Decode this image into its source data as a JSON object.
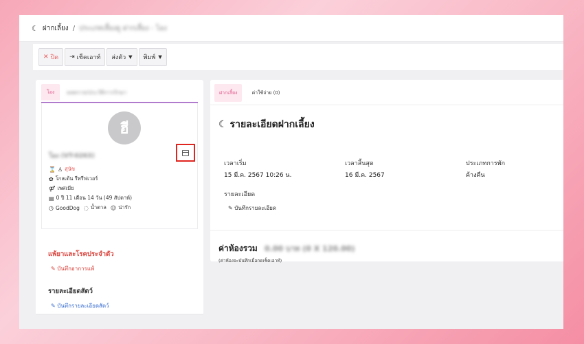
{
  "breadcrumb": {
    "root": "ฝากเลี้ยง",
    "separator": "/",
    "current": "ประเภทเลี้ยงดู ฝากเลี้ยง - โอง"
  },
  "toolbar": {
    "close_label": "ปิด",
    "checkout_label": "เช็คเอาท์",
    "send_label": "ส่งตัว",
    "print_label": "พิมพ์"
  },
  "left_panel": {
    "tab_active": "โอง",
    "tab_other": "ผลตรวจ/ประวัติการรักษา",
    "avatar_letter": "ฮี",
    "pet_name": "โอง (VT-0263)",
    "rows": [
      {
        "icon": "⌛",
        "text": "สุนัข",
        "emphasis": "red"
      },
      {
        "icon": "✿",
        "text": "โกลเด้น รีทรีฟเวอร์"
      },
      {
        "icon": "⚤",
        "text": "เพศเมีย"
      },
      {
        "icon": "▤",
        "text": "0 ปี 11 เดือน 14 วัน (49 สัปดาห์)"
      },
      {
        "icon": "◷",
        "text": "GoodDog"
      },
      {
        "icon": "◌",
        "text": "น้ำตาล"
      },
      {
        "icon": "☺",
        "text": "น่ารัก"
      }
    ],
    "allergy_title": "แพ้ยาและโรคประจำตัว",
    "allergy_link": "บันทึกอาการแพ้",
    "details_title": "รายละเอียดสัตว์",
    "details_link": "บันทึกรายละเอียดสัตว์"
  },
  "right_panel": {
    "tab_active": "ฝากเลี้ยง",
    "tab_expense": "ค่าใช้จ่าย (0)",
    "title": "รายละเอียดฝากเลี้ยง",
    "start_label": "เวลาเริ่ม",
    "start_value": "15 มี.ค. 2567 10:26 น.",
    "end_label": "เวลาสิ้นสุด",
    "end_value": "16 มี.ค. 2567",
    "type_label": "ประเภทการพัก",
    "type_value": "ค้างคืน",
    "detail_label": "รายละเอียด",
    "detail_link": "บันทึกรายละเอียด",
    "total_label": "ค่าห้องรวม",
    "total_value": "0.00 บาท (0 X 120.00)",
    "total_note": "(ค่าห้องจะบันทึกเมื่อกดเช็คเอาท์)"
  },
  "colors": {
    "accent_pink": "#e0588a",
    "tab_bg": "#fde8ef",
    "alert_red": "#d9423b",
    "highlight_box": "#e0241f",
    "link_blue": "#3a6fd0"
  }
}
